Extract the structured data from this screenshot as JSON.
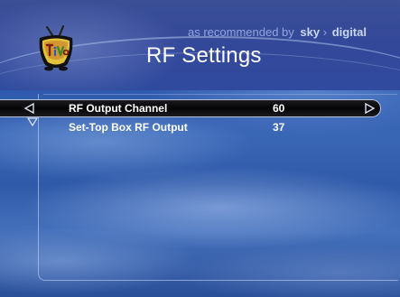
{
  "header": {
    "recommended_text": "as recommended by",
    "brand_sky": "sky",
    "brand_digital": "digital",
    "title": "RF Settings"
  },
  "settings": [
    {
      "label": "RF Output Channel",
      "value": "60",
      "selected": true
    },
    {
      "label": "Set-Top Box RF Output",
      "value": "37",
      "selected": false
    }
  ],
  "icons": {
    "logo": "tivo-logo",
    "left": "triangle-left-icon",
    "right": "triangle-right-icon",
    "down": "triangle-down-icon"
  },
  "colors": {
    "background": "#2a56aa",
    "header": "#34489a",
    "selected_row": "#050507",
    "text": "#ffffff",
    "accent_text": "#8fa6de"
  }
}
